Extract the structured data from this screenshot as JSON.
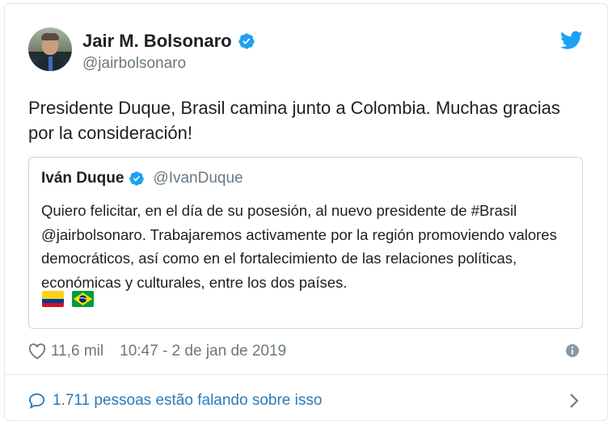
{
  "author": {
    "name": "Jair M. Bolsonaro",
    "handle": "@jairbolsonaro"
  },
  "tweet": {
    "text": "Presidente Duque, Brasil camina junto a Colombia. Muchas gracias por la consideración!"
  },
  "quoted_tweet": {
    "name": "Iván Duque",
    "handle": "@IvanDuque",
    "text": "Quiero felicitar, en el día de su posesión, al nuevo presidente de #Brasil @jairbolsonaro. Trabajaremos activamente por la región promoviendo valores democráticos, así como en el fortalecimiento de las relaciones políticas, económicas y culturales, entre los dos países.",
    "flags": [
      "colombia-flag-icon",
      "brazil-flag-icon"
    ]
  },
  "meta": {
    "likes": "11,6 mil",
    "timestamp": "10:47 - 2 de jan de 2019"
  },
  "footer": {
    "conversation": "1.711 pessoas estão falando sobre isso"
  },
  "colors": {
    "twitter_blue": "#1da1f2",
    "link_blue": "#2b7bb9",
    "muted": "#697882",
    "text": "#1c2022",
    "border": "#e1e8ed"
  }
}
